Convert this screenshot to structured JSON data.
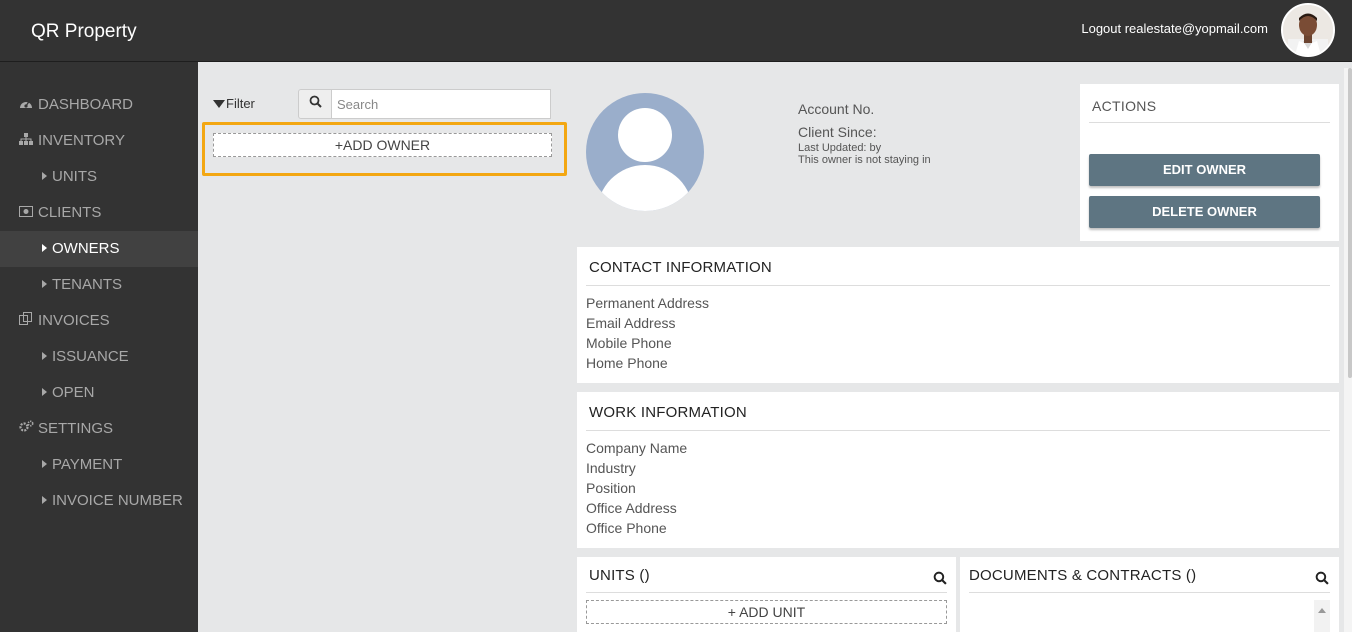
{
  "header": {
    "brand": "QR Property",
    "logout_text": "Logout realestate@yopmail.com"
  },
  "sidebar": {
    "items": [
      {
        "label": "DASHBOARD",
        "icon": "dashboard-icon"
      },
      {
        "label": "INVENTORY",
        "icon": "sitemap-icon"
      },
      {
        "label": "UNITS",
        "icon": "caret-right-icon"
      },
      {
        "label": "CLIENTS",
        "icon": "money-icon"
      },
      {
        "label": "OWNERS",
        "icon": "caret-right-icon",
        "active": true
      },
      {
        "label": "TENANTS",
        "icon": "caret-right-icon"
      },
      {
        "label": "INVOICES",
        "icon": "copy-icon"
      },
      {
        "label": "ISSUANCE",
        "icon": "caret-right-icon"
      },
      {
        "label": "OPEN",
        "icon": "caret-right-icon"
      },
      {
        "label": "SETTINGS",
        "icon": "gears-icon"
      },
      {
        "label": "PAYMENT",
        "icon": "caret-right-icon"
      },
      {
        "label": "INVOICE NUMBER",
        "icon": "caret-right-icon"
      }
    ]
  },
  "list": {
    "filter_label": "Filter",
    "search_placeholder": "Search",
    "add_owner_label": "+ADD OWNER"
  },
  "profile": {
    "account_no_label": "Account No.",
    "client_since_label": "Client Since:",
    "last_updated": "Last Updated: by",
    "staying_note": "This owner is not staying in"
  },
  "actions": {
    "title": "ACTIONS",
    "edit_label": "EDIT OWNER",
    "delete_label": "DELETE OWNER"
  },
  "contact": {
    "title": "CONTACT INFORMATION",
    "fields": [
      "Permanent Address",
      "Email Address",
      "Mobile Phone",
      "Home Phone"
    ]
  },
  "work": {
    "title": "WORK INFORMATION",
    "fields": [
      "Company Name",
      "Industry",
      "Position",
      "Office Address",
      "Office Phone"
    ]
  },
  "units": {
    "title": "UNITS ()",
    "add_label": "+ ADD UNIT"
  },
  "documents": {
    "title": "DOCUMENTS & CONTRACTS ()"
  },
  "colors": {
    "header_bg": "#333333",
    "sidebar_active": "#414141",
    "action_button": "#5e7582",
    "highlight": "#f3a712",
    "avatar_placeholder": "#9aaecb"
  }
}
